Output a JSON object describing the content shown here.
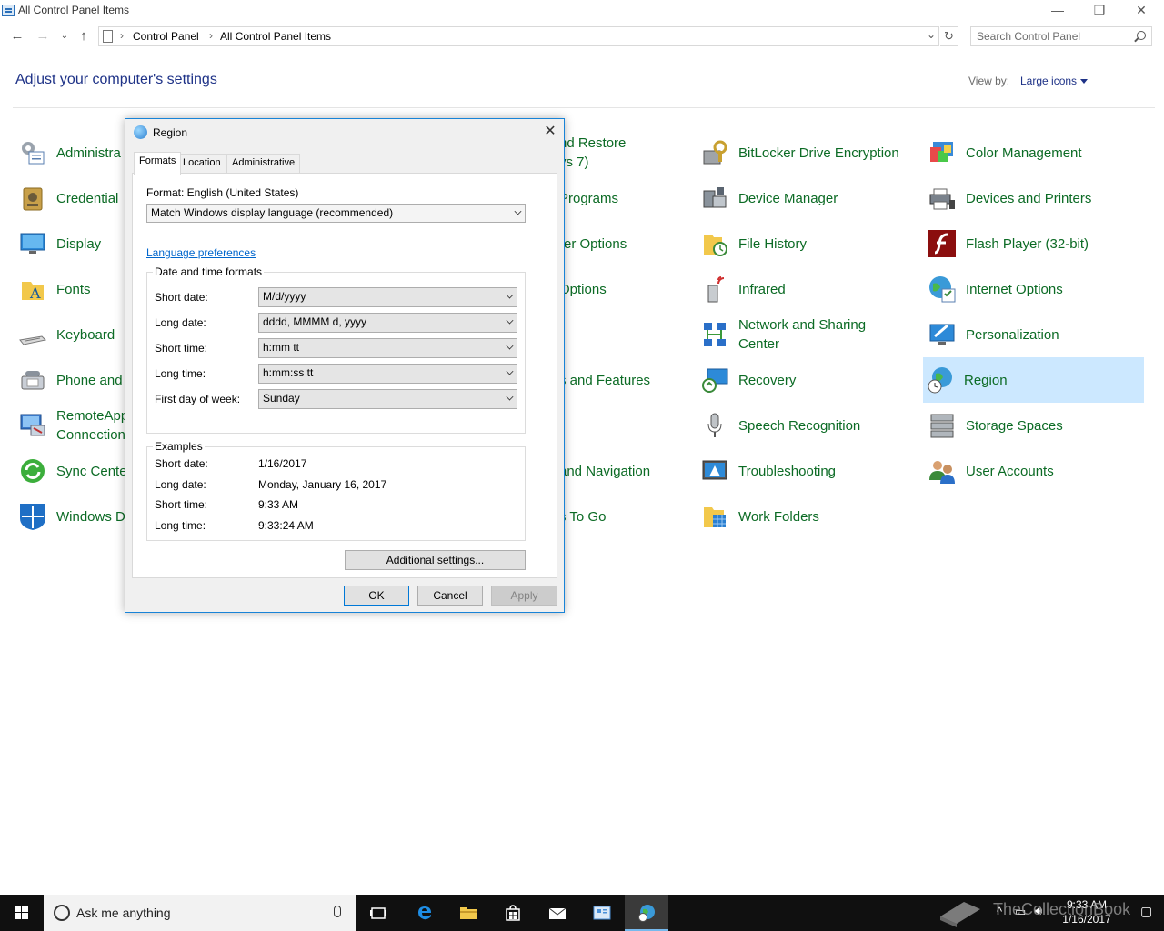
{
  "window": {
    "title": "All Control Panel Items",
    "controls": {
      "minimize": "—",
      "maximize": "❐",
      "close": "✕"
    }
  },
  "address": {
    "crumbs": [
      "Control Panel",
      "All Control Panel Items"
    ],
    "search_placeholder": "Search Control Panel"
  },
  "header": {
    "heading": "Adjust your computer's settings",
    "view_by_label": "View by:",
    "view_by_value": "Large icons"
  },
  "items": {
    "col1": [
      "Administra",
      "Credential",
      "Display",
      "Fonts",
      "Keyboard",
      "Phone and",
      "RemoteApp\nConnection",
      "Sync Cente",
      "Windows D"
    ],
    "col3": [
      "nd Restore\nvs 7)",
      "Programs",
      "rer Options",
      "Options",
      "",
      "s and Features",
      "",
      "and Navigation",
      "s To Go"
    ],
    "col4": [
      "BitLocker Drive Encryption",
      "Device Manager",
      "File History",
      "Infrared",
      "Network and Sharing\nCenter",
      "Recovery",
      "Speech Recognition",
      "Troubleshooting",
      "Work Folders"
    ],
    "col5": [
      "Color Management",
      "Devices and Printers",
      "Flash Player (32-bit)",
      "Internet Options",
      "Personalization",
      "Region",
      "Storage Spaces",
      "User Accounts"
    ]
  },
  "dialog": {
    "title": "Region",
    "tabs": [
      "Formats",
      "Location",
      "Administrative"
    ],
    "format_label": "Format: English (United States)",
    "format_value": "Match Windows display language (recommended)",
    "language_link": "Language preferences",
    "group_datetime": "Date and time formats",
    "short_date_label": "Short date:",
    "short_date_value": "M/d/yyyy",
    "long_date_label": "Long date:",
    "long_date_value": "dddd, MMMM d, yyyy",
    "short_time_label": "Short time:",
    "short_time_value": "h:mm tt",
    "long_time_label": "Long time:",
    "long_time_value": "h:mm:ss tt",
    "first_day_label": "First day of week:",
    "first_day_value": "Sunday",
    "group_examples": "Examples",
    "ex_short_date_label": "Short date:",
    "ex_short_date": "1/16/2017",
    "ex_long_date_label": "Long date:",
    "ex_long_date": "Monday, January 16, 2017",
    "ex_short_time_label": "Short time:",
    "ex_short_time": "9:33 AM",
    "ex_long_time_label": "Long time:",
    "ex_long_time": "9:33:24 AM",
    "additional": "Additional settings...",
    "ok": "OK",
    "cancel": "Cancel",
    "apply": "Apply"
  },
  "taskbar": {
    "search_text": "Ask me anything",
    "clock_time": "9:33 AM",
    "clock_date": "1/16/2017",
    "watermark": "TheCollectionBook"
  }
}
